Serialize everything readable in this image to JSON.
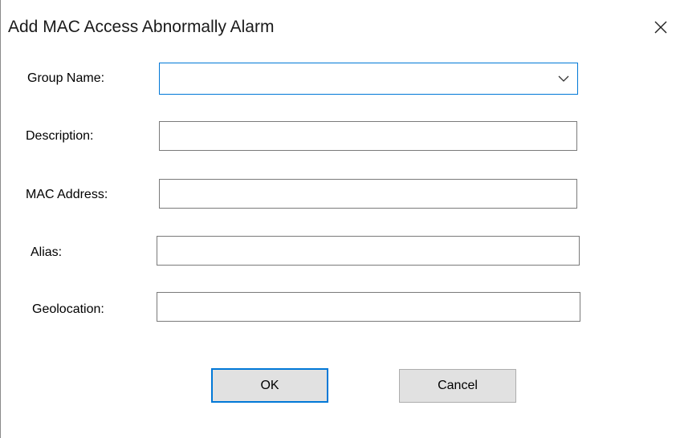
{
  "dialog": {
    "title": "Add MAC Access Abnormally Alarm",
    "close_icon": "close-icon"
  },
  "form": {
    "group_name": {
      "label": "Group Name:",
      "value": "",
      "icon": "chevron-down-icon"
    },
    "description": {
      "label": "Description:",
      "value": ""
    },
    "mac_address": {
      "label": "MAC Address:",
      "value": ""
    },
    "alias": {
      "label": "Alias:",
      "value": ""
    },
    "geolocation": {
      "label": "Geolocation:",
      "value": ""
    }
  },
  "buttons": {
    "ok": "OK",
    "cancel": "Cancel"
  },
  "colors": {
    "accent": "#0078d7",
    "button_face": "#e1e1e1",
    "field_border": "#7a7a7a"
  }
}
